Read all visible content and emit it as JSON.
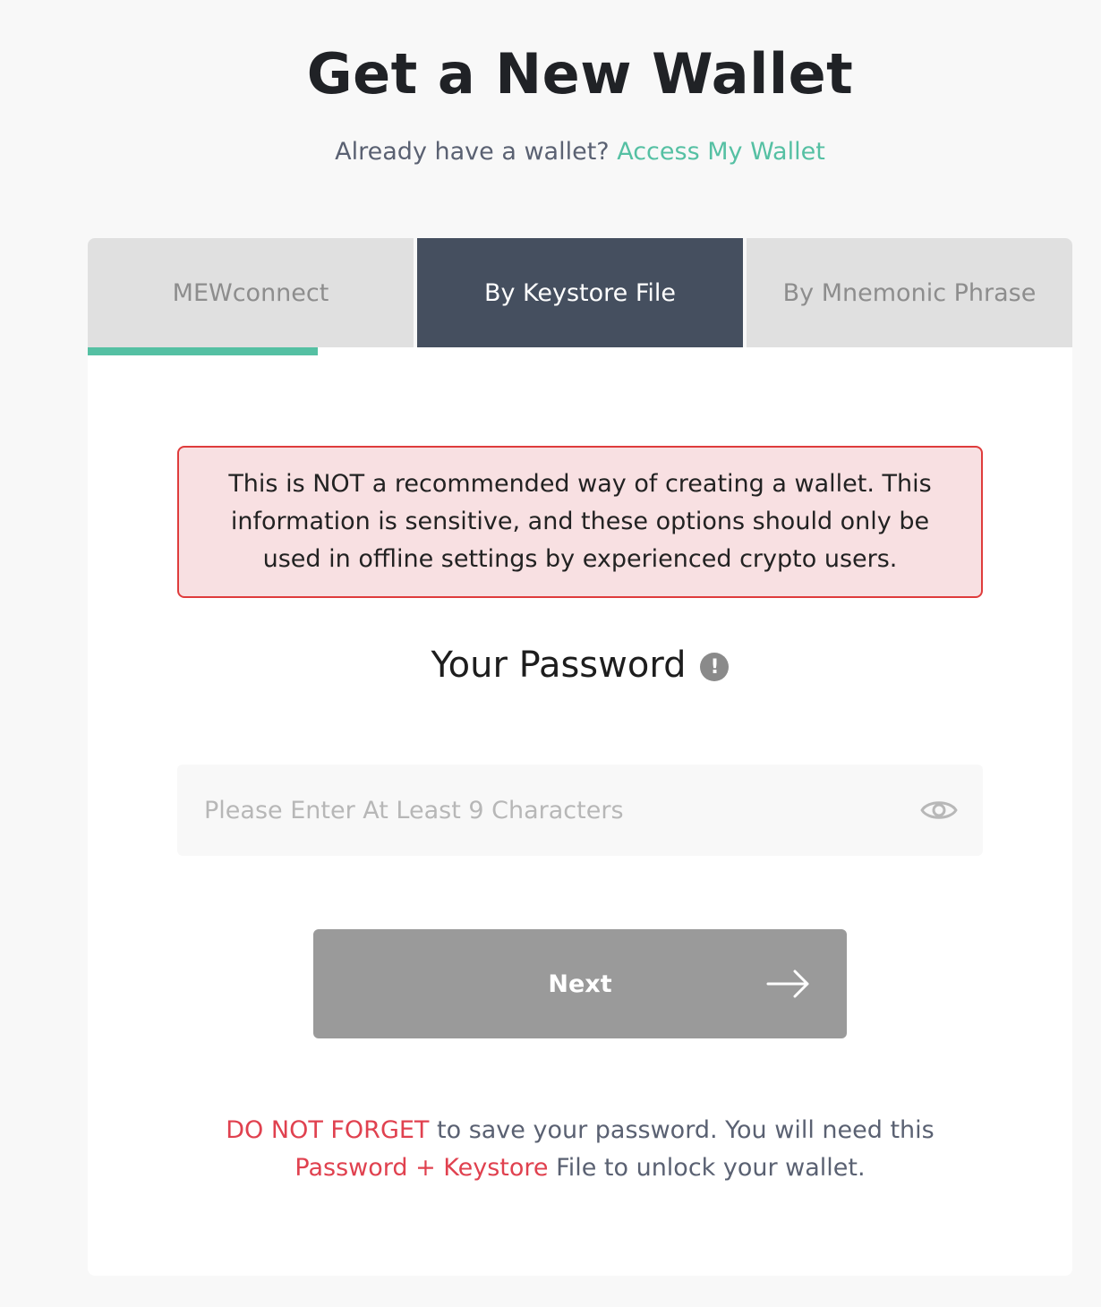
{
  "header": {
    "title": "Get a New Wallet",
    "subtitle_prefix": "Already have a wallet?",
    "access_link": "Access My Wallet"
  },
  "tabs": [
    {
      "label": "MEWconnect",
      "active": false
    },
    {
      "label": "By Keystore File",
      "active": true
    },
    {
      "label": "By Mnemonic Phrase",
      "active": false
    }
  ],
  "warning": {
    "text": "This is NOT a recommended way of creating a wallet. This information is sensitive, and these options should only be used in offline settings by experienced crypto users."
  },
  "password": {
    "title": "Your Password",
    "info_icon": "exclamation-circle-icon",
    "placeholder": "Please Enter At Least 9 Characters",
    "value": "",
    "toggle_icon": "eye-icon"
  },
  "next_button": {
    "label": "Next",
    "icon": "arrow-right-icon"
  },
  "note": {
    "emphasis1": "DO NOT FORGET",
    "text1": " to save your password. You will need this ",
    "emphasis2": "Password + Keystore",
    "text2": " File to unlock your wallet."
  },
  "colors": {
    "accent": "#55c0a3",
    "active_tab": "#454f5f",
    "inactive_tab": "#e0e0e0",
    "warning_bg": "#f8e0e2",
    "warning_border": "#df3c3c",
    "danger_text": "#e0414f",
    "button_disabled": "#9a9a9a"
  }
}
